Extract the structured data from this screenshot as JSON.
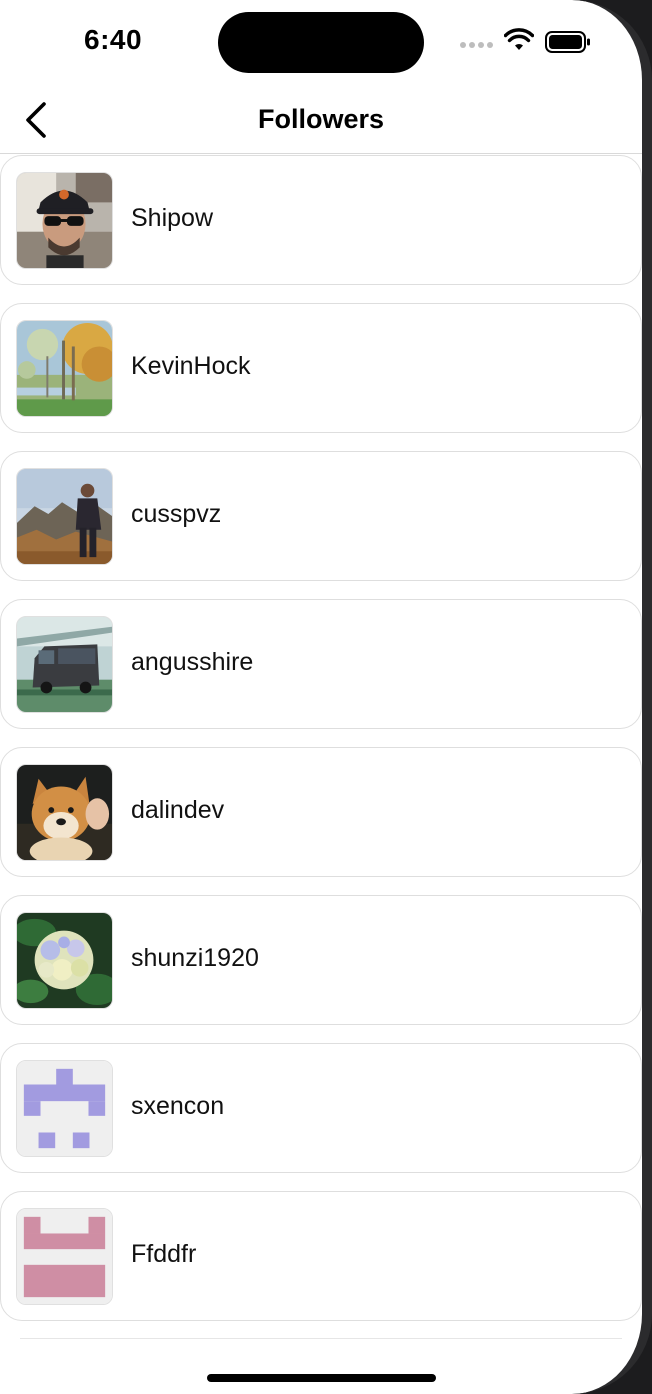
{
  "status_bar": {
    "time": "6:40"
  },
  "nav": {
    "title": "Followers"
  },
  "followers": [
    {
      "username": "Shipow",
      "avatar": "photo-man-cap-sunglasses"
    },
    {
      "username": "KevinHock",
      "avatar": "painting-landscape"
    },
    {
      "username": "cusspvz",
      "avatar": "photo-man-mountain"
    },
    {
      "username": "angusshire",
      "avatar": "photo-van"
    },
    {
      "username": "dalindev",
      "avatar": "photo-shiba-dog"
    },
    {
      "username": "shunzi1920",
      "avatar": "photo-hydrangea"
    },
    {
      "username": "sxencon",
      "avatar": "identicon-purple"
    },
    {
      "username": "Ffddfr",
      "avatar": "identicon-pink"
    }
  ],
  "colors": {
    "identicon_purple": "#a29be0",
    "identicon_pink": "#cf8ea4",
    "background": "#ffffff"
  }
}
